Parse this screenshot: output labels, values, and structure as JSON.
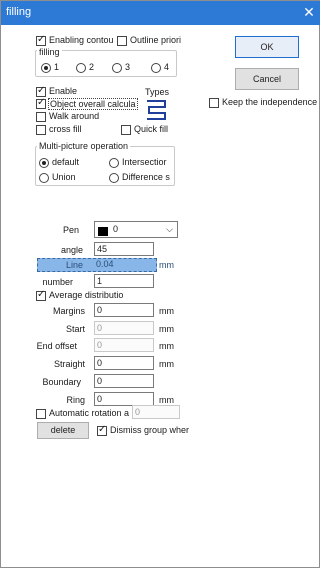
{
  "window": {
    "title": "filling",
    "close_glyph": "✕"
  },
  "colors": {
    "titlebar": "#2c7ad6",
    "selected_row": "#88b6e8"
  },
  "buttons": {
    "ok": "OK",
    "cancel": "Cancel",
    "delete": "delete"
  },
  "checkboxes": {
    "enabling_contour": "Enabling contou",
    "outline_priority": "Outline priori",
    "keep_independence": "Keep the independence",
    "enable": "Enable",
    "object_overall": "Object overall calcula",
    "walk_around": "Walk around",
    "cross_fill": "cross fill",
    "quick_fill": "Quick fill",
    "average_distribution": "Average distributio",
    "automatic_rotation": "Automatic rotation a",
    "dismiss_group": "Dismiss group wher"
  },
  "filling_group": {
    "label": "filling",
    "options": [
      "1",
      "2",
      "3",
      "4"
    ],
    "selected": "1"
  },
  "types_label": "Types",
  "multi_picture": {
    "label": "Multi-picture operation",
    "options": [
      "default",
      "Intersectior",
      "Union",
      "Difference s"
    ],
    "selected": "default"
  },
  "fields": {
    "pen": {
      "label": "Pen",
      "value": "0",
      "swatch_color": "#000000"
    },
    "angle": {
      "label": "angle",
      "value": "45"
    },
    "line": {
      "label": "Line",
      "value": "0.04",
      "unit": "mm"
    },
    "number": {
      "label": "number",
      "value": "1"
    },
    "margins": {
      "label": "Margins",
      "value": "0",
      "unit": "mm"
    },
    "start": {
      "label": "Start",
      "value": "0",
      "unit": "mm"
    },
    "end_offset": {
      "label": "End offset",
      "value": "0",
      "unit": "mm"
    },
    "straight": {
      "label": "Straight",
      "value": "0",
      "unit": "mm"
    },
    "boundary": {
      "label": "Boundary",
      "value": "0"
    },
    "ring": {
      "label": "Ring",
      "value": "0",
      "unit": "mm"
    },
    "auto_rotation_value": "0"
  }
}
